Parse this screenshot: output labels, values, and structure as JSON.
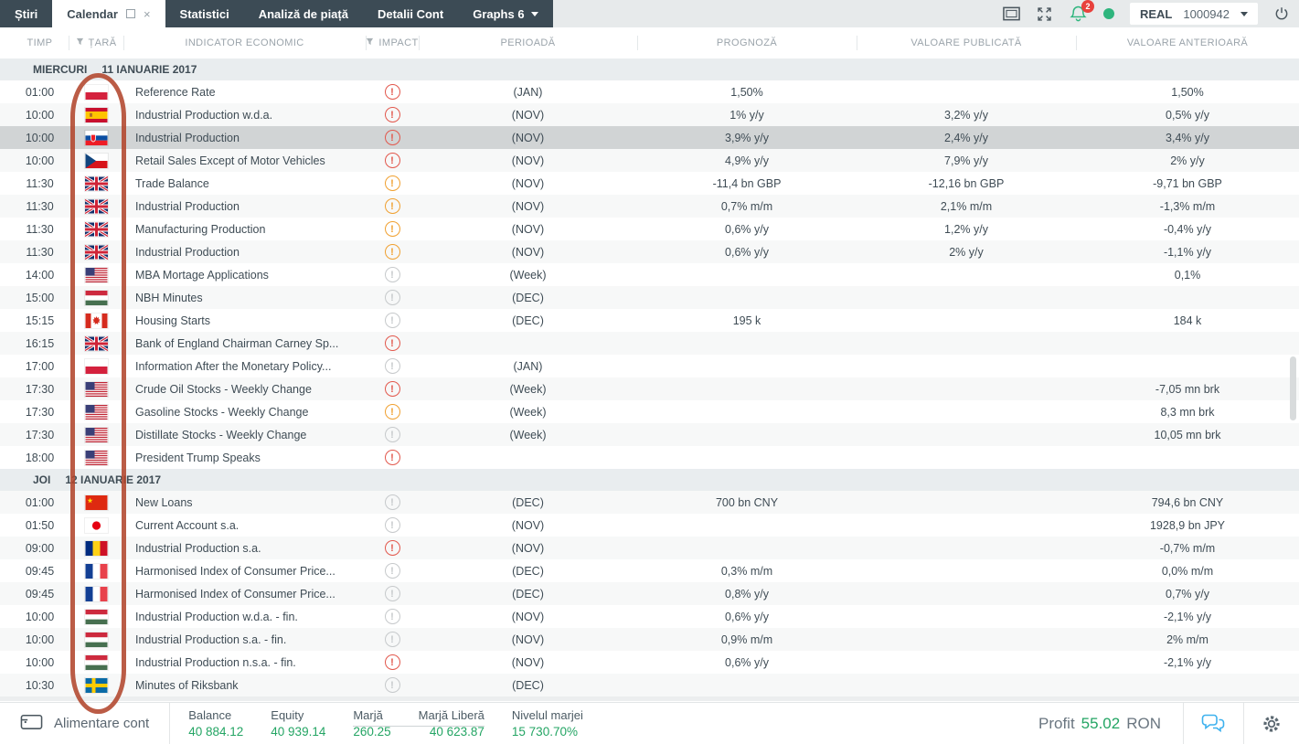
{
  "colors": {
    "accent_green": "#24a564",
    "impact_high": "#e2574c",
    "impact_medium": "#f0a030",
    "impact_low": "#c6c9cb",
    "annotation_red": "#b2452c",
    "chat_blue": "#3db1ee",
    "tabbar_dark": "#3c4b55"
  },
  "topbar": {
    "tabs": [
      {
        "label": "Știri",
        "state": "dark"
      },
      {
        "label": "Calendar",
        "state": "active",
        "has_restore": true,
        "has_close": true
      },
      {
        "label": "Statistici",
        "state": "dark"
      },
      {
        "label": "Analiză de piață",
        "state": "dark"
      },
      {
        "label": "Detalii Cont",
        "state": "dark"
      },
      {
        "label": "Graphs 6",
        "state": "dark",
        "has_dropdown": true
      }
    ],
    "notification_badge": "2",
    "account_type": "REAL",
    "account_number": "1000942"
  },
  "table": {
    "columns": [
      {
        "key": "time",
        "label": "TIMP",
        "filter": false
      },
      {
        "key": "country",
        "label": "ȚARĂ",
        "filter": true
      },
      {
        "key": "indicator",
        "label": "INDICATOR ECONOMIC",
        "filter": false
      },
      {
        "key": "impact",
        "label": "IMPACT",
        "filter": true
      },
      {
        "key": "period",
        "label": "PERIOADĂ",
        "filter": false
      },
      {
        "key": "forecast",
        "label": "PROGNOZĂ",
        "filter": false
      },
      {
        "key": "published",
        "label": "VALOARE PUBLICATĂ",
        "filter": false
      },
      {
        "key": "previous",
        "label": "VALOARE ANTERIOARĂ",
        "filter": false
      }
    ],
    "sections": [
      {
        "day": "MIERCURI",
        "date": "11 IANUARIE 2017",
        "rows": [
          {
            "time": "01:00",
            "country": "pl",
            "indicator": "Reference Rate",
            "impact": "high",
            "period": "(JAN)",
            "forecast": "1,50%",
            "published": "",
            "previous": "1,50%"
          },
          {
            "time": "10:00",
            "country": "es",
            "indicator": "Industrial Production w.d.a.",
            "impact": "high",
            "period": "(NOV)",
            "forecast": "1% y/y",
            "published": "3,2% y/y",
            "previous": "0,5% y/y"
          },
          {
            "time": "10:00",
            "country": "sk",
            "indicator": "Industrial Production",
            "impact": "high",
            "period": "(NOV)",
            "forecast": "3,9% y/y",
            "published": "2,4% y/y",
            "previous": "3,4% y/y",
            "selected": true
          },
          {
            "time": "10:00",
            "country": "cz",
            "indicator": "Retail Sales Except of Motor Vehicles",
            "impact": "high",
            "period": "(NOV)",
            "forecast": "4,9% y/y",
            "published": "7,9% y/y",
            "previous": "2% y/y"
          },
          {
            "time": "11:30",
            "country": "gb",
            "indicator": "Trade Balance",
            "impact": "medium",
            "period": "(NOV)",
            "forecast": "-11,4 bn GBP",
            "published": "-12,16 bn GBP",
            "previous": "-9,71 bn GBP"
          },
          {
            "time": "11:30",
            "country": "gb",
            "indicator": "Industrial Production",
            "impact": "medium",
            "period": "(NOV)",
            "forecast": "0,7% m/m",
            "published": "2,1% m/m",
            "previous": "-1,3% m/m"
          },
          {
            "time": "11:30",
            "country": "gb",
            "indicator": "Manufacturing Production",
            "impact": "medium",
            "period": "(NOV)",
            "forecast": "0,6% y/y",
            "published": "1,2% y/y",
            "previous": "-0,4% y/y"
          },
          {
            "time": "11:30",
            "country": "gb",
            "indicator": "Industrial Production",
            "impact": "medium",
            "period": "(NOV)",
            "forecast": "0,6% y/y",
            "published": "2% y/y",
            "previous": "-1,1% y/y"
          },
          {
            "time": "14:00",
            "country": "us",
            "indicator": "MBA Mortage Applications",
            "impact": "low",
            "period": "(Week)",
            "forecast": "",
            "published": "",
            "previous": "0,1%"
          },
          {
            "time": "15:00",
            "country": "hu",
            "indicator": "NBH Minutes",
            "impact": "low",
            "period": "(DEC)",
            "forecast": "",
            "published": "",
            "previous": ""
          },
          {
            "time": "15:15",
            "country": "ca",
            "indicator": "Housing Starts",
            "impact": "low",
            "period": "(DEC)",
            "forecast": "195 k",
            "published": "",
            "previous": "184 k"
          },
          {
            "time": "16:15",
            "country": "gb",
            "indicator": "Bank of England Chairman Carney Sp...",
            "impact": "high",
            "period": "",
            "forecast": "",
            "published": "",
            "previous": ""
          },
          {
            "time": "17:00",
            "country": "pl",
            "indicator": "Information After the Monetary Policy...",
            "impact": "low",
            "period": "(JAN)",
            "forecast": "",
            "published": "",
            "previous": ""
          },
          {
            "time": "17:30",
            "country": "us",
            "indicator": "Crude Oil Stocks - Weekly Change",
            "impact": "high",
            "period": "(Week)",
            "forecast": "",
            "published": "",
            "previous": "-7,05 mn brk"
          },
          {
            "time": "17:30",
            "country": "us",
            "indicator": "Gasoline Stocks - Weekly Change",
            "impact": "medium",
            "period": "(Week)",
            "forecast": "",
            "published": "",
            "previous": "8,3 mn brk"
          },
          {
            "time": "17:30",
            "country": "us",
            "indicator": "Distillate Stocks - Weekly Change",
            "impact": "low",
            "period": "(Week)",
            "forecast": "",
            "published": "",
            "previous": "10,05 mn brk"
          },
          {
            "time": "18:00",
            "country": "us",
            "indicator": "President Trump Speaks",
            "impact": "high",
            "period": "",
            "forecast": "",
            "published": "",
            "previous": ""
          }
        ]
      },
      {
        "day": "JOI",
        "date": "12 IANUARIE 2017",
        "rows": [
          {
            "time": "01:00",
            "country": "cn",
            "indicator": "New Loans",
            "impact": "low",
            "period": "(DEC)",
            "forecast": "700 bn CNY",
            "published": "",
            "previous": "794,6 bn CNY"
          },
          {
            "time": "01:50",
            "country": "jp",
            "indicator": "Current Account s.a.",
            "impact": "low",
            "period": "(NOV)",
            "forecast": "",
            "published": "",
            "previous": "1928,9 bn JPY"
          },
          {
            "time": "09:00",
            "country": "ro",
            "indicator": "Industrial Production s.a.",
            "impact": "high",
            "period": "(NOV)",
            "forecast": "",
            "published": "",
            "previous": "-0,7% m/m"
          },
          {
            "time": "09:45",
            "country": "fr",
            "indicator": "Harmonised Index of Consumer Price...",
            "impact": "low",
            "period": "(DEC)",
            "forecast": "0,3% m/m",
            "published": "",
            "previous": "0,0% m/m"
          },
          {
            "time": "09:45",
            "country": "fr",
            "indicator": "Harmonised Index of Consumer Price...",
            "impact": "low",
            "period": "(DEC)",
            "forecast": "0,8% y/y",
            "published": "",
            "previous": "0,7% y/y"
          },
          {
            "time": "10:00",
            "country": "hu",
            "indicator": "Industrial Production w.d.a. - fin.",
            "impact": "low",
            "period": "(NOV)",
            "forecast": "0,6% y/y",
            "published": "",
            "previous": "-2,1% y/y"
          },
          {
            "time": "10:00",
            "country": "hu",
            "indicator": "Industrial Production s.a. - fin.",
            "impact": "low",
            "period": "(NOV)",
            "forecast": "0,9% m/m",
            "published": "",
            "previous": "2% m/m"
          },
          {
            "time": "10:00",
            "country": "hu",
            "indicator": "Industrial Production n.s.a. - fin.",
            "impact": "high",
            "period": "(NOV)",
            "forecast": "0,6% y/y",
            "published": "",
            "previous": "-2,1% y/y"
          },
          {
            "time": "10:30",
            "country": "se",
            "indicator": "Minutes of Riksbank",
            "impact": "low",
            "period": "(DEC)",
            "forecast": "",
            "published": "",
            "previous": ""
          }
        ]
      }
    ]
  },
  "footer": {
    "deposit_label": "Alimentare cont",
    "stats": [
      {
        "label": "Balance",
        "value": "40 884.12"
      },
      {
        "label": "Equity",
        "value": "40 939.14"
      },
      {
        "label": "Marjă",
        "value": "260.25",
        "group": "margin"
      },
      {
        "label": "Marjă Liberă",
        "value": "40 623.87",
        "group": "margin",
        "align": "right"
      },
      {
        "label": "Nivelul marjei",
        "value": "15 730.70%"
      }
    ],
    "profit_label": "Profit",
    "profit_value": "55.02",
    "profit_currency": "RON"
  }
}
